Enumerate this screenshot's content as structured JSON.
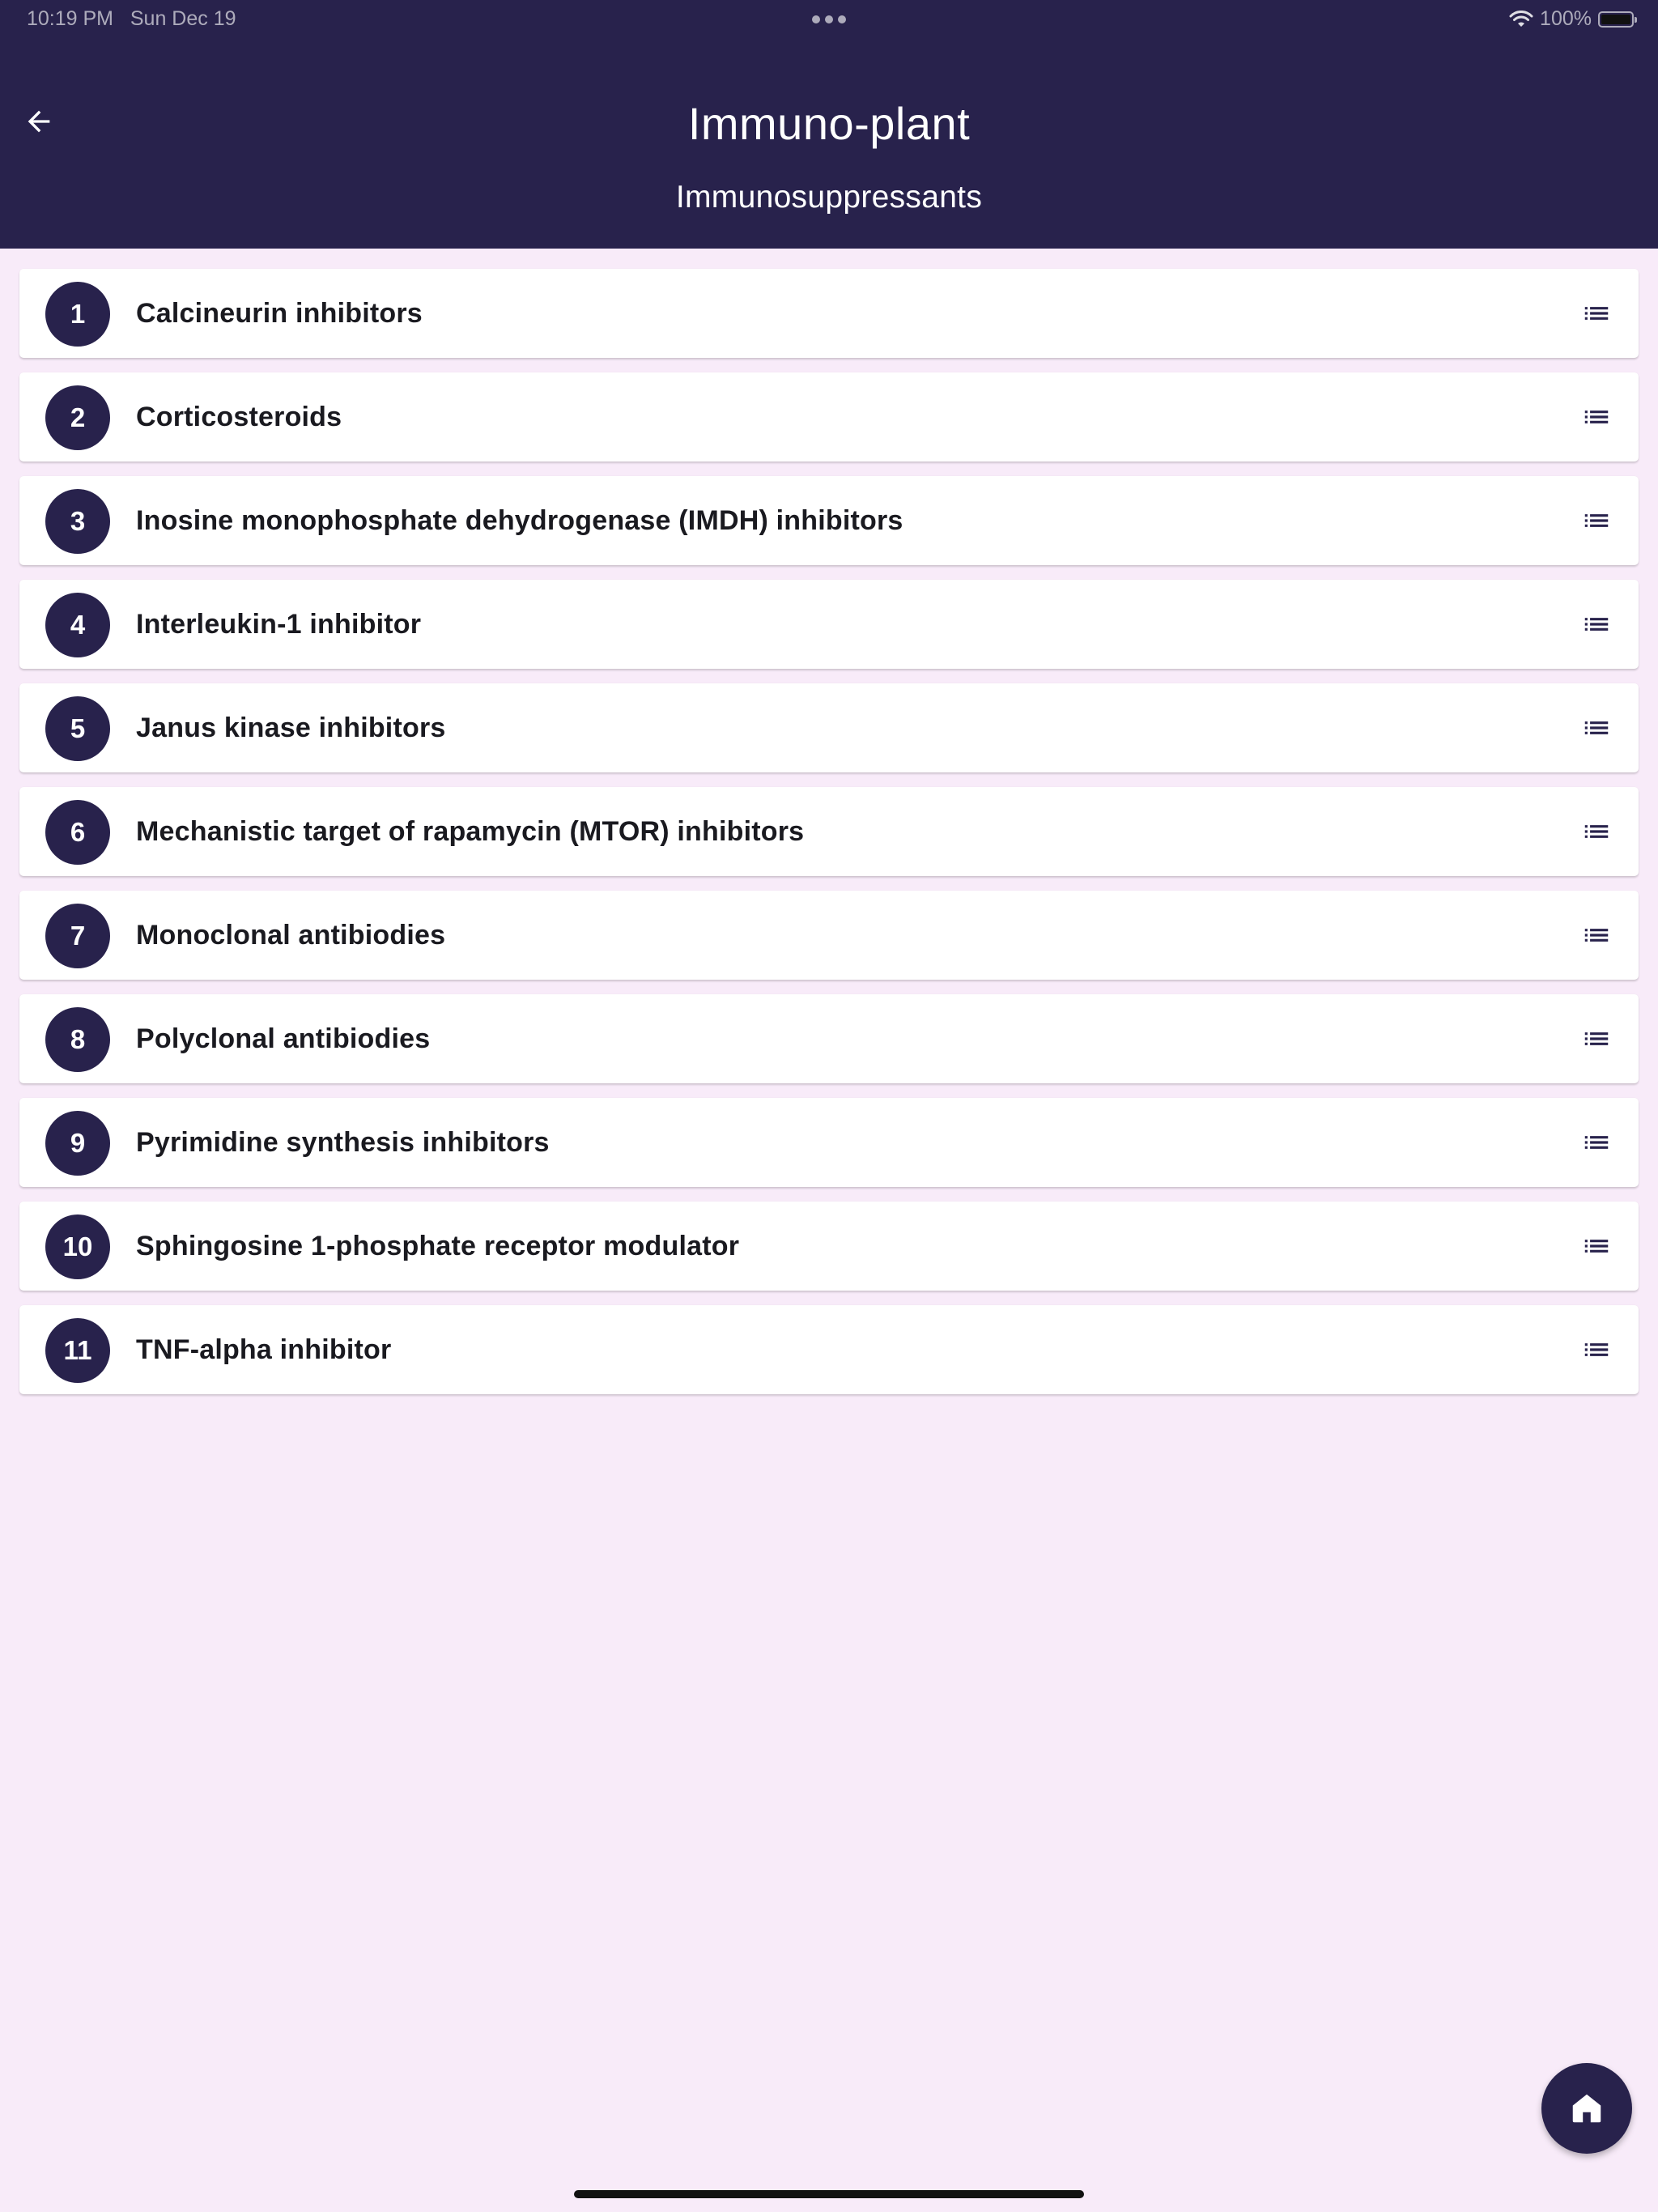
{
  "status_bar": {
    "time": "10:19 PM",
    "date": "Sun Dec 19",
    "battery_text": "100%",
    "icons": [
      "wifi-icon",
      "battery-icon",
      "multitask-dots-icon"
    ]
  },
  "header": {
    "title": "Immuno-plant",
    "subtitle": "Immunosuppressants",
    "back_icon": "arrow-left-icon"
  },
  "items": [
    {
      "number": "1",
      "label": "Calcineurin inhibitors"
    },
    {
      "number": "2",
      "label": "Corticosteroids"
    },
    {
      "number": "3",
      "label": "Inosine monophosphate dehydrogenase (IMDH) inhibitors"
    },
    {
      "number": "4",
      "label": "Interleukin-1 inhibitor"
    },
    {
      "number": "5",
      "label": "Janus kinase inhibitors"
    },
    {
      "number": "6",
      "label": "Mechanistic target of rapamycin (MTOR) inhibitors"
    },
    {
      "number": "7",
      "label": "Monoclonal antibiodies"
    },
    {
      "number": "8",
      "label": "Polyclonal antibiodies"
    },
    {
      "number": "9",
      "label": "Pyrimidine synthesis inhibitors"
    },
    {
      "number": "10",
      "label": "Sphingosine 1-phosphate receptor modulator"
    },
    {
      "number": "11",
      "label": "TNF-alpha inhibitor"
    }
  ],
  "item_icon": "list-icon",
  "fab": {
    "icon": "home-icon"
  },
  "colors": {
    "primary": "#28224c",
    "background": "#f8ebf9",
    "card": "#ffffff",
    "on_primary": "#ffffff"
  }
}
